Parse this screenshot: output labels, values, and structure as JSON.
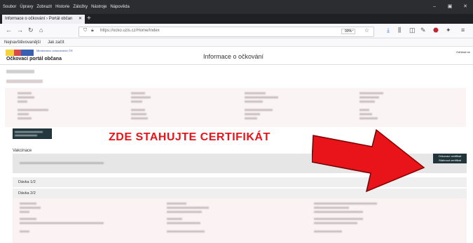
{
  "menu": {
    "items": [
      "Soubor",
      "Úpravy",
      "Zobrazit",
      "Historie",
      "Záložky",
      "Nástroje",
      "Nápověda"
    ]
  },
  "tab": {
    "label": "Informace o očkování › Portál občan",
    "close": "✕",
    "new": "+"
  },
  "address": {
    "url": "https://ocko.uzis.cz/Home/Index",
    "zoom": "90%"
  },
  "bookmarks": [
    "Nejnavštěvovanější",
    "Jak začít"
  ],
  "page": {
    "logo_text": "Ministerstvo zdravotnictví ČR",
    "site_title": "Očkovací portál občana",
    "title": "Informace o očkování",
    "user": "Odhlásit se",
    "section_label": "Vakcinace",
    "cert_button": "Očkovací certifikát Stáhnout certifikát",
    "dose1": "Dávka 1/2",
    "dose2": "Dávka 2/2"
  },
  "annotation": {
    "text": "ZDE STAHUJTE CERTIFIKÁT",
    "color": "#e8141a"
  }
}
